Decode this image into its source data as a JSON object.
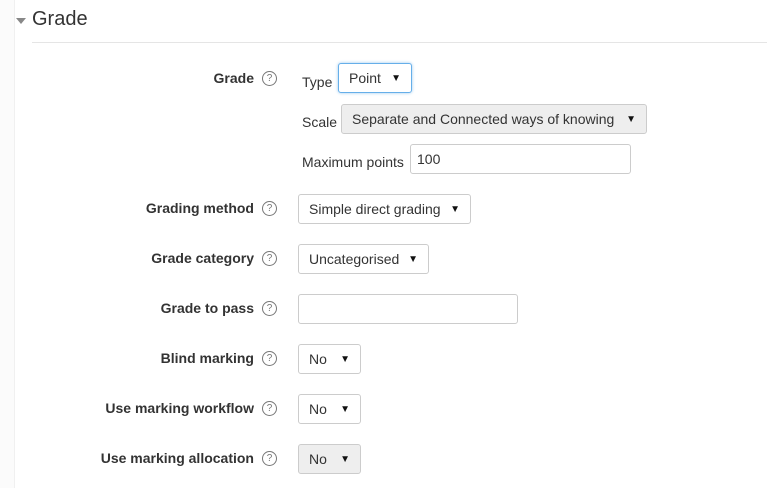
{
  "section": {
    "title": "Grade"
  },
  "grade": {
    "label": "Grade",
    "type_label": "Type",
    "type_value": "Point",
    "scale_label": "Scale",
    "scale_value": "Separate and Connected ways of knowing",
    "max_points_label": "Maximum points",
    "max_points_value": "100"
  },
  "grading_method": {
    "label": "Grading method",
    "value": "Simple direct grading"
  },
  "grade_category": {
    "label": "Grade category",
    "value": "Uncategorised"
  },
  "grade_to_pass": {
    "label": "Grade to pass",
    "value": ""
  },
  "blind_marking": {
    "label": "Blind marking",
    "value": "No"
  },
  "marking_workflow": {
    "label": "Use marking workflow",
    "value": "No"
  },
  "marking_allocation": {
    "label": "Use marking allocation",
    "value": "No"
  },
  "help_glyph": "?",
  "dropdown_glyph": "▼"
}
